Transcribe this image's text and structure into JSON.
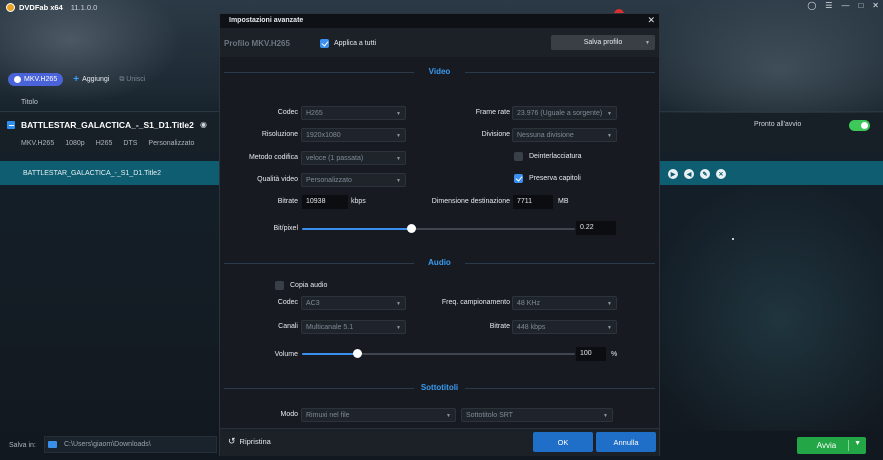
{
  "app": {
    "name": "DVDFab x64",
    "version": "11.1.0.0",
    "window_controls": [
      "restore-icon",
      "menu-icon",
      "minimize-icon",
      "maximize-icon",
      "close-icon"
    ]
  },
  "toolbar": {
    "profile_label": "MKV.H265",
    "add_label": "Aggiungi",
    "merge_label": "Unisci"
  },
  "file_list": {
    "column_title": "Titolo",
    "file_title": "BATTLESTAR_GALACTICA_-_S1_D1.Title2",
    "meta": [
      "MKV.H265",
      "1080p",
      "H265",
      "DTS",
      "Personalizzato"
    ],
    "status": "Pronto all'avvio",
    "title_row_label": "BATTLESTAR_GALACTICA_-_S1_D1.Title2",
    "row_icons": [
      "play-icon",
      "back-icon",
      "edit-icon",
      "remove-icon"
    ]
  },
  "bottom": {
    "save_label": "Salva in:",
    "path": "C:\\Users\\giaom\\Downloads\\",
    "start_label": "Avvia"
  },
  "dialog": {
    "title": "Impostazioni avanzate",
    "profile_name": "Profilo MKV.H265",
    "apply_all_label": "Applica a tutti",
    "save_profile_label": "Salva profilo",
    "video": {
      "section_title": "Video",
      "codec_label": "Codec",
      "codec_value": "H265",
      "resolution_label": "Risoluzione",
      "resolution_value": "1920x1080",
      "encode_method_label": "Metodo codifica",
      "encode_method_value": "veloce (1 passata)",
      "quality_label": "Qualità video",
      "quality_value": "Personalizzato",
      "bitrate_label": "Bitrate",
      "bitrate_value": "10938",
      "bitrate_unit": "kbps",
      "framerate_label": "Frame rate",
      "framerate_value": "23.976 (Uguale a sorgente)",
      "division_label": "Divisione",
      "division_value": "Nessuna divisione",
      "deinterlace_label": "Deinterlacciatura",
      "preserve_chapters_label": "Preserva capitoli",
      "dest_size_label": "Dimensione destinazione",
      "dest_size_value": "7711",
      "dest_size_unit": "MB",
      "bitpixel_label": "Bit/pixel",
      "bitpixel_value": "0.22",
      "bitpixel_fraction": 0.4
    },
    "audio": {
      "section_title": "Audio",
      "copy_audio_label": "Copia audio",
      "codec_label": "Codec",
      "codec_value": "AC3",
      "channels_label": "Canali",
      "channels_value": "Multicanale 5.1",
      "samplerate_label": "Freq. campionamento",
      "samplerate_value": "48 KHz",
      "bitrate_label": "Bitrate",
      "bitrate_value": "448 kbps",
      "volume_label": "Volume",
      "volume_value": "100",
      "volume_unit": "%",
      "volume_fraction": 0.2
    },
    "subtitles": {
      "section_title": "Sottotitoli",
      "mode_label": "Modo",
      "mode_value": "Rimuxi nel file",
      "format_value": "Sottotitolo SRT"
    },
    "footer": {
      "reset_label": "Ripristina",
      "ok_label": "OK",
      "cancel_label": "Annulla"
    }
  },
  "colors": {
    "accent": "#3a8ff0",
    "primary_button": "#1f6ec8",
    "start_button": "#23a645",
    "title_row": "#0f5d70"
  }
}
